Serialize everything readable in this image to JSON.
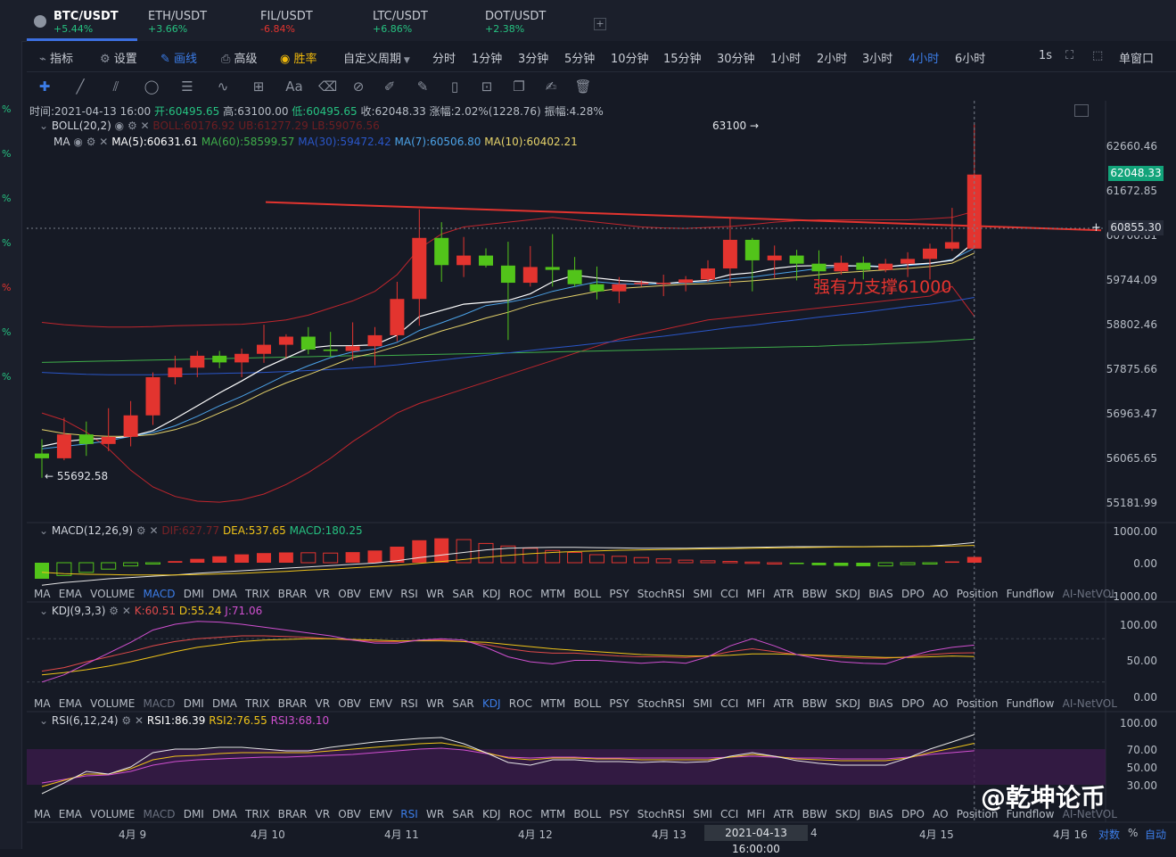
{
  "tabs": [
    {
      "symbol": "BTC/USDT",
      "change": "+5.44%",
      "color": "#26c281",
      "active": true
    },
    {
      "symbol": "ETH/USDT",
      "change": "+3.66%",
      "color": "#26c281"
    },
    {
      "symbol": "FIL/USDT",
      "change": "-6.84%",
      "color": "#e3342f"
    },
    {
      "symbol": "LTC/USDT",
      "change": "+6.86%",
      "color": "#26c281"
    },
    {
      "symbol": "DOT/USDT",
      "change": "+2.38%",
      "color": "#26c281"
    }
  ],
  "add_tab": "+",
  "toolbar": {
    "indicators": "指标",
    "settings": "设置",
    "draw": "画线",
    "advanced": "高级",
    "winrate": "胜率",
    "custom_period": "自定义周期",
    "periods": [
      "分时",
      "1分钟",
      "3分钟",
      "5分钟",
      "10分钟",
      "15分钟",
      "30分钟",
      "1小时",
      "2小时",
      "3小时",
      "4小时",
      "6小时"
    ],
    "active_period": "4小时",
    "one_s": "1s",
    "single_window": "单窗口"
  },
  "left_strip": [
    "%",
    "%",
    "%",
    "%",
    "%",
    "%",
    "%"
  ],
  "ohlc": {
    "time": "时间:2021-04-13 16:00",
    "open": "开:60495.65",
    "high": "高:63100.00",
    "low": "低:60495.65",
    "close": "收:62048.33",
    "change": "涨幅:2.02%(1228.76)",
    "amplitude": "振幅:4.28%"
  },
  "boll": {
    "label": "BOLL(20,2)",
    "mid": "BOLL:60176.92",
    "ub": "UB:61277.29",
    "lb": "LB:59076.56"
  },
  "ma": {
    "label": "MA",
    "ma5": "MA(5):60631.61",
    "ma60": "MA(60):58599.57",
    "ma30": "MA(30):59472.42",
    "ma7": "MA(7):60506.80",
    "ma10": "MA(10):60402.21"
  },
  "macd": {
    "label": "MACD(12,26,9)",
    "dif": "DIF:627.77",
    "dea": "DEA:537.65",
    "macd": "MACD:180.25"
  },
  "kdj": {
    "label": "KDJ(9,3,3)",
    "k": "K:60.51",
    "d": "D:55.24",
    "j": "J:71.06"
  },
  "rsi": {
    "label": "RSI(6,12,24)",
    "rsi1": "RSI1:86.39",
    "rsi2": "RSI2:76.55",
    "rsi3": "RSI3:68.10"
  },
  "indicator_tabs": [
    "MA",
    "EMA",
    "VOLUME",
    "MACD",
    "DMI",
    "DMA",
    "TRIX",
    "BRAR",
    "VR",
    "OBV",
    "EMV",
    "RSI",
    "WR",
    "SAR",
    "KDJ",
    "ROC",
    "MTM",
    "BOLL",
    "PSY",
    "StochRSI",
    "SMI",
    "CCI",
    "MFI",
    "ATR",
    "BBW",
    "SKDJ",
    "BIAS",
    "DPO",
    "AO",
    "Position",
    "Fundflow",
    "AI-NetVOL"
  ],
  "price_axis": [
    "62660.46",
    "61672.85",
    "60700.81",
    "59744.09",
    "58802.46",
    "57875.66",
    "56963.47",
    "56065.65",
    "55181.99"
  ],
  "macd_axis": [
    "1000.00",
    "0.00",
    "-1000.00"
  ],
  "kdj_axis": [
    "100.00",
    "50.00",
    "0.00"
  ],
  "rsi_axis": [
    "100.00",
    "70.00",
    "50.00",
    "30.00"
  ],
  "last_price": "62048.33",
  "crosshair_price": "60855.30",
  "high_marker": "63100 →",
  "low_marker": "← 55692.58",
  "dates": [
    "4月 9",
    "4月 10",
    "4月 11",
    "4月 12",
    "4月 13",
    "4",
    "4月 15",
    "4月 16"
  ],
  "crosshair_time": "2021-04-13 16:00:00",
  "bottom_controls": [
    "对数",
    "%",
    "自动"
  ],
  "annotation": "强有力支撑61000",
  "watermark": "@乾坤论币",
  "colors": {
    "up": "#e3342f",
    "down": "#52c41a",
    "boll": "#c0262d",
    "ma5": "#ffffff",
    "ma7": "#4ca3e8",
    "ma10": "#e6d36a",
    "ma30": "#2a56c8",
    "ma60": "#3fae4a",
    "dif": "#e6e6e6",
    "dea": "#f0c419",
    "k": "#e04a4a",
    "d": "#f0c419",
    "j": "#d050d0"
  },
  "chart_data": {
    "type": "candlestick",
    "interval": "4小时",
    "trendline": {
      "from": 61470,
      "to": 60880
    },
    "candles": [
      [
        56200,
        56500,
        55692.58,
        56100
      ],
      [
        56100,
        56950,
        56060,
        56600
      ],
      [
        56600,
        56870,
        56150,
        56400
      ],
      [
        56400,
        57150,
        56250,
        56550
      ],
      [
        56550,
        57300,
        56350,
        57000
      ],
      [
        57000,
        57900,
        56800,
        57800
      ],
      [
        57800,
        58250,
        57650,
        58000
      ],
      [
        58000,
        58350,
        57800,
        58250
      ],
      [
        58250,
        58350,
        57990,
        58110
      ],
      [
        58110,
        58400,
        57800,
        58290
      ],
      [
        58290,
        58900,
        58100,
        58480
      ],
      [
        58480,
        58700,
        58200,
        58650
      ],
      [
        58650,
        58850,
        58280,
        58380
      ],
      [
        58380,
        58750,
        58230,
        58350
      ],
      [
        58350,
        58950,
        58150,
        58450
      ],
      [
        58450,
        58850,
        58050,
        58680
      ],
      [
        58680,
        59800,
        58550,
        59440
      ],
      [
        59440,
        61320,
        58880,
        60720
      ],
      [
        60720,
        61050,
        59800,
        60150
      ],
      [
        60150,
        60740,
        59900,
        60350
      ],
      [
        60350,
        60500,
        60100,
        60140
      ],
      [
        60140,
        60640,
        58580,
        59780
      ],
      [
        59780,
        60550,
        59700,
        60110
      ],
      [
        60110,
        60800,
        59700,
        60050
      ],
      [
        60050,
        60320,
        59700,
        59750
      ],
      [
        59750,
        60120,
        59430,
        59600
      ],
      [
        59600,
        59900,
        59350,
        59750
      ],
      [
        59750,
        59830,
        59700,
        59780
      ],
      [
        59780,
        59950,
        59500,
        59780
      ],
      [
        59780,
        59920,
        59600,
        59850
      ],
      [
        59850,
        60250,
        59800,
        60080
      ],
      [
        60080,
        61150,
        59700,
        60680
      ],
      [
        60680,
        60720,
        59600,
        60250
      ],
      [
        60250,
        60560,
        59880,
        60350
      ],
      [
        60350,
        60470,
        59830,
        60180
      ],
      [
        60180,
        60460,
        59660,
        60020
      ],
      [
        60020,
        60350,
        59950,
        60200
      ],
      [
        60200,
        60330,
        59850,
        60050
      ],
      [
        60050,
        60280,
        60000,
        60180
      ],
      [
        60180,
        60420,
        59900,
        60280
      ],
      [
        60280,
        60600,
        59850,
        60495.65
      ],
      [
        60495.65,
        61350,
        60450,
        60631.61
      ],
      [
        60495.65,
        63100,
        60495.65,
        62048.33
      ]
    ],
    "ma5": [
      56350,
      56450,
      56500,
      56520,
      56560,
      56680,
      56930,
      57200,
      57470,
      57720,
      57990,
      58200,
      58410,
      58460,
      58460,
      58480,
      58680,
      59070,
      59200,
      59330,
      59370,
      59410,
      59550,
      59800,
      59940,
      59880,
      59830,
      59800,
      59760,
      59800,
      59830,
      59950,
      59990,
      60080,
      60130,
      60140,
      60140,
      60130,
      60110,
      60160,
      60190,
      60250,
      60631.61
    ],
    "ma7": [
      56300,
      56350,
      56400,
      56470,
      56560,
      56640,
      56780,
      56980,
      57200,
      57400,
      57620,
      57850,
      58040,
      58210,
      58330,
      58390,
      58530,
      58780,
      58940,
      59110,
      59300,
      59370,
      59460,
      59600,
      59700,
      59800,
      59760,
      59750,
      59760,
      59780,
      59800,
      59860,
      59900,
      59960,
      60020,
      60080,
      60120,
      60140,
      60120,
      60140,
      60180,
      60270,
      60506.8
    ],
    "ma10": [
      56700,
      56620,
      56580,
      56560,
      56560,
      56600,
      56700,
      56850,
      57050,
      57250,
      57480,
      57680,
      57850,
      58030,
      58210,
      58310,
      58450,
      58610,
      58770,
      58900,
      59040,
      59160,
      59310,
      59420,
      59510,
      59600,
      59660,
      59690,
      59720,
      59750,
      59760,
      59790,
      59820,
      59860,
      59900,
      59950,
      59990,
      60020,
      60050,
      60080,
      60120,
      60190,
      60402.21
    ],
    "ma30": [
      57900,
      57880,
      57860,
      57850,
      57850,
      57850,
      57860,
      57870,
      57880,
      57890,
      57900,
      57920,
      57940,
      57960,
      57990,
      58020,
      58060,
      58110,
      58160,
      58210,
      58260,
      58310,
      58360,
      58410,
      58460,
      58510,
      58560,
      58610,
      58660,
      58720,
      58780,
      58840,
      58890,
      58950,
      59000,
      59060,
      59110,
      59160,
      59220,
      59280,
      59330,
      59390,
      59472.42
    ],
    "ma60": [
      58110,
      58120,
      58130,
      58140,
      58150,
      58160,
      58170,
      58180,
      58190,
      58200,
      58210,
      58220,
      58230,
      58240,
      58250,
      58250,
      58260,
      58270,
      58280,
      58290,
      58300,
      58310,
      58320,
      58330,
      58340,
      58350,
      58360,
      58370,
      58380,
      58390,
      58400,
      58410,
      58420,
      58430,
      58440,
      58450,
      58470,
      58480,
      58500,
      58520,
      58540,
      58570,
      58599.57
    ],
    "boll_ub": [
      58950,
      58900,
      58870,
      58850,
      58850,
      58860,
      58880,
      58890,
      58900,
      58910,
      58950,
      59000,
      59100,
      59250,
      59400,
      59600,
      59950,
      60500,
      60800,
      60950,
      61000,
      61050,
      61100,
      61150,
      61100,
      61050,
      61000,
      60950,
      60930,
      60920,
      60940,
      60960,
      61000,
      61050,
      61080,
      61100,
      61100,
      61100,
      61100,
      61100,
      61120,
      61150,
      61277.29
    ],
    "boll_lb": [
      57050,
      56900,
      56650,
      56300,
      55850,
      55500,
      55300,
      55200,
      55180,
      55230,
      55350,
      55550,
      55800,
      56100,
      56450,
      56750,
      57050,
      57250,
      57400,
      57550,
      57700,
      57850,
      58000,
      58150,
      58300,
      58450,
      58600,
      58700,
      58800,
      58900,
      59000,
      59050,
      59100,
      59150,
      59200,
      59250,
      59300,
      59350,
      59400,
      59450,
      59500,
      59700,
      59076.56
    ],
    "macd_hist": [
      -500,
      -400,
      -300,
      -200,
      -100,
      -20,
      50,
      120,
      200,
      260,
      300,
      320,
      310,
      300,
      330,
      380,
      500,
      700,
      760,
      720,
      600,
      520,
      450,
      380,
      320,
      250,
      200,
      160,
      120,
      80,
      60,
      40,
      20,
      0,
      -40,
      -80,
      -100,
      -110,
      -100,
      -60,
      -20,
      40,
      180.25
    ],
    "dif": [
      -700,
      -620,
      -560,
      -500,
      -460,
      -420,
      -380,
      -330,
      -290,
      -250,
      -210,
      -170,
      -130,
      -90,
      -50,
      -10,
      60,
      160,
      240,
      320,
      400,
      450,
      470,
      480,
      480,
      470,
      460,
      450,
      450,
      450,
      460,
      470,
      480,
      490,
      500,
      500,
      500,
      500,
      510,
      510,
      520,
      560,
      627.77
    ],
    "dea": [
      -300,
      -340,
      -360,
      -370,
      -380,
      -380,
      -380,
      -370,
      -350,
      -330,
      -300,
      -270,
      -230,
      -200,
      -160,
      -120,
      -80,
      -20,
      40,
      100,
      170,
      230,
      280,
      320,
      350,
      370,
      390,
      400,
      410,
      420,
      430,
      440,
      450,
      460,
      470,
      480,
      490,
      495,
      500,
      505,
      510,
      520,
      537.65
    ],
    "k": [
      35,
      40,
      48,
      55,
      62,
      70,
      76,
      80,
      82,
      84,
      84,
      83,
      82,
      80,
      78,
      76,
      76,
      78,
      78,
      76,
      72,
      66,
      62,
      60,
      60,
      58,
      56,
      55,
      55,
      54,
      56,
      62,
      66,
      62,
      58,
      56,
      54,
      53,
      53,
      55,
      58,
      60,
      60.51
    ],
    "d": [
      30,
      33,
      37,
      42,
      48,
      55,
      62,
      68,
      72,
      76,
      78,
      79,
      80,
      80,
      79,
      78,
      77,
      77,
      77,
      76,
      75,
      72,
      69,
      66,
      64,
      62,
      60,
      58,
      57,
      56,
      56,
      57,
      59,
      59,
      58,
      57,
      56,
      55,
      54,
      54,
      55,
      56,
      55.24
    ],
    "j": [
      20,
      30,
      45,
      60,
      75,
      92,
      100,
      104,
      103,
      100,
      96,
      92,
      88,
      84,
      78,
      74,
      74,
      78,
      80,
      78,
      68,
      55,
      48,
      45,
      50,
      50,
      48,
      46,
      48,
      46,
      55,
      70,
      80,
      70,
      58,
      52,
      48,
      46,
      45,
      55,
      63,
      68,
      71.06
    ],
    "rsi1": [
      20,
      32,
      45,
      42,
      50,
      66,
      70,
      70,
      72,
      72,
      70,
      68,
      68,
      72,
      75,
      78,
      80,
      82,
      83,
      76,
      66,
      55,
      52,
      58,
      58,
      56,
      56,
      55,
      56,
      55,
      56,
      62,
      66,
      62,
      57,
      54,
      52,
      52,
      52,
      60,
      70,
      78,
      86.39
    ],
    "rsi2": [
      28,
      35,
      42,
      42,
      48,
      58,
      62,
      63,
      65,
      66,
      66,
      66,
      66,
      68,
      70,
      72,
      74,
      76,
      77,
      73,
      66,
      60,
      58,
      60,
      60,
      59,
      59,
      58,
      58,
      58,
      58,
      61,
      64,
      62,
      59,
      58,
      57,
      57,
      57,
      60,
      66,
      71,
      76.55
    ],
    "rsi3": [
      32,
      36,
      40,
      41,
      45,
      52,
      56,
      58,
      59,
      60,
      61,
      61,
      62,
      63,
      64,
      66,
      68,
      70,
      71,
      69,
      65,
      61,
      60,
      61,
      61,
      60,
      60,
      60,
      60,
      60,
      60,
      61,
      62,
      61,
      60,
      60,
      59,
      59,
      59,
      61,
      64,
      66,
      68.1
    ]
  }
}
